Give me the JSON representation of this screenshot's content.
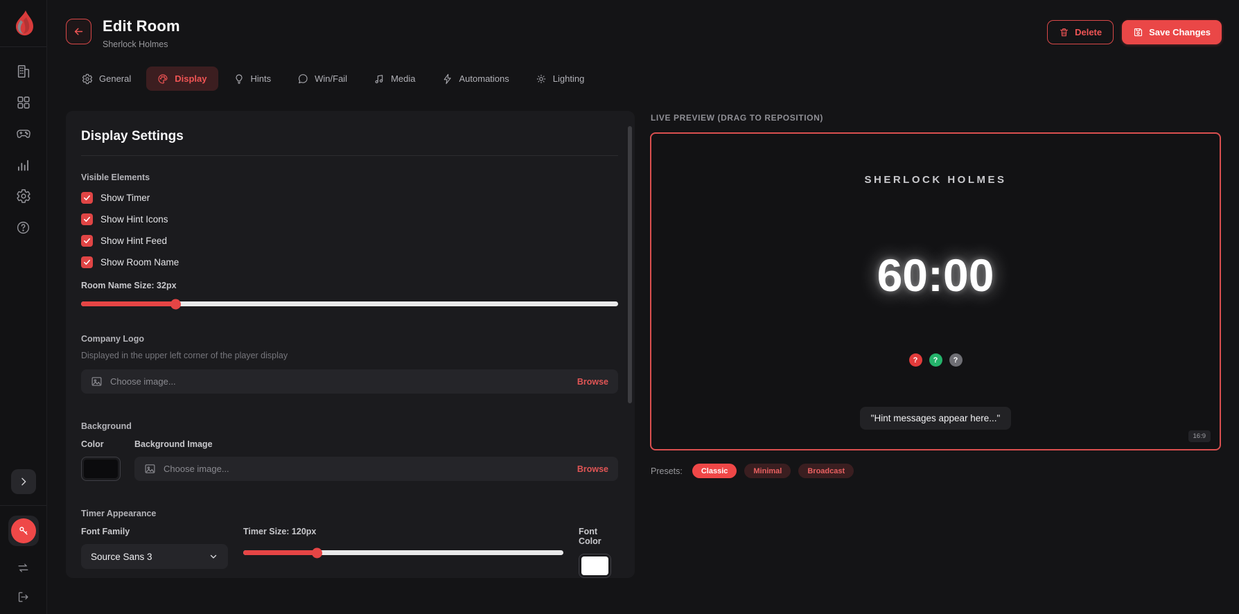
{
  "colors": {
    "accent": "#ef4848",
    "hint_red": "#e23b3b",
    "hint_green": "#24b36b",
    "hint_gray": "#6e6e74"
  },
  "header": {
    "title": "Edit Room",
    "subtitle": "Sherlock Holmes",
    "delete": "Delete",
    "save": "Save Changes"
  },
  "tabs": [
    {
      "label": "General"
    },
    {
      "label": "Display",
      "active": true
    },
    {
      "label": "Hints"
    },
    {
      "label": "Win/Fail"
    },
    {
      "label": "Media"
    },
    {
      "label": "Automations"
    },
    {
      "label": "Lighting"
    }
  ],
  "panel": {
    "title": "Display Settings",
    "visible_elements_label": "Visible Elements",
    "checkboxes": [
      {
        "label": "Show Timer",
        "checked": true
      },
      {
        "label": "Show Hint Icons",
        "checked": true
      },
      {
        "label": "Show Hint Feed",
        "checked": true
      },
      {
        "label": "Show Room Name",
        "checked": true
      }
    ],
    "room_name_size_label": "Room Name Size: 32px",
    "room_name_size_percent": 17.5,
    "company_logo_label": "Company Logo",
    "company_logo_desc": "Displayed in the upper left corner of the player display",
    "logo_placeholder": "Choose image...",
    "logo_browse": "Browse",
    "background_label": "Background",
    "bg_color_label": "Color",
    "bg_color_value": "#0b0b0d",
    "bg_image_label": "Background Image",
    "bg_placeholder": "Choose image...",
    "bg_browse": "Browse",
    "timer_appearance_label": "Timer Appearance",
    "font_family_label": "Font Family",
    "font_family_value": "Source Sans 3",
    "timer_size_label": "Timer Size: 120px",
    "timer_size_percent": 23,
    "font_color_label": "Font Color",
    "font_color_value": "#ffffff"
  },
  "preview": {
    "label": "LIVE PREVIEW (DRAG TO REPOSITION)",
    "room_name": "SHERLOCK HOLMES",
    "timer": "60:00",
    "hint_message": "\"Hint messages appear here...\"",
    "aspect": "16:9",
    "presets_label": "Presets:",
    "presets": [
      {
        "label": "Classic",
        "active": true
      },
      {
        "label": "Minimal",
        "active": false
      },
      {
        "label": "Broadcast",
        "active": false
      }
    ]
  }
}
